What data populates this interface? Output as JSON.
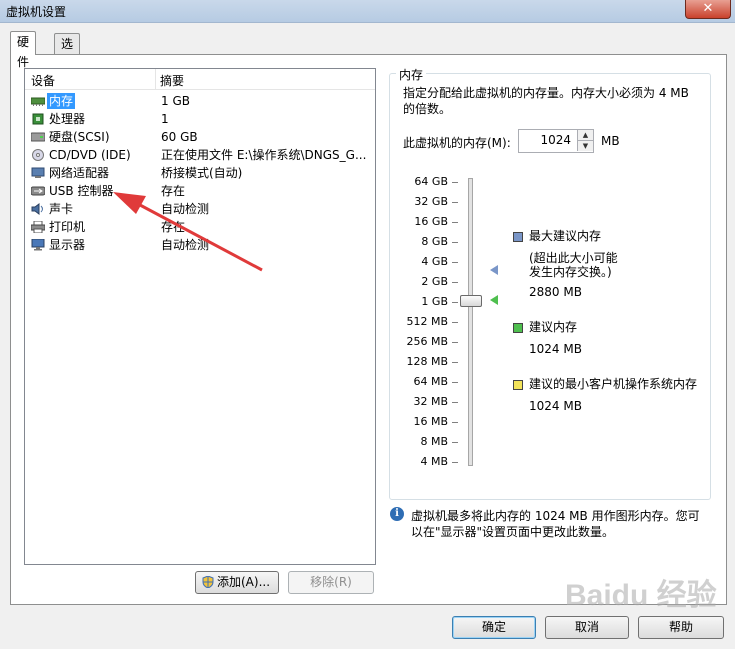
{
  "window": {
    "title": "虚拟机设置",
    "close_glyph": "✕"
  },
  "tabs": [
    {
      "label": "硬件"
    },
    {
      "label": "选项"
    }
  ],
  "device_list": {
    "columns": [
      "设备",
      "摘要"
    ],
    "rows": [
      {
        "name": "内存",
        "summary": "1 GB",
        "icon": "memory-icon"
      },
      {
        "name": "处理器",
        "summary": "1",
        "icon": "processor-icon"
      },
      {
        "name": "硬盘(SCSI)",
        "summary": "60 GB",
        "icon": "hard-disk-icon"
      },
      {
        "name": "CD/DVD (IDE)",
        "summary": "正在使用文件 E:\\操作系统\\DNGS_G...",
        "icon": "cd-dvd-icon"
      },
      {
        "name": "网络适配器",
        "summary": "桥接模式(自动)",
        "icon": "network-adapter-icon"
      },
      {
        "name": "USB 控制器",
        "summary": "存在",
        "icon": "usb-icon"
      },
      {
        "name": "声卡",
        "summary": "自动检测",
        "icon": "sound-card-icon"
      },
      {
        "name": "打印机",
        "summary": "存在",
        "icon": "printer-icon"
      },
      {
        "name": "显示器",
        "summary": "自动检测",
        "icon": "display-icon"
      }
    ]
  },
  "buttons": {
    "add": "添加(A)...",
    "remove": "移除(R)",
    "ok": "确定",
    "cancel": "取消",
    "help": "帮助"
  },
  "memory": {
    "group_title": "内存",
    "description": "指定分配给此虚拟机的内存量。内存大小必须为 4 MB 的倍数。",
    "label": "此虚拟机的内存(M):",
    "value": "1024",
    "unit": "MB",
    "scale": [
      "64 GB",
      "32 GB",
      "16 GB",
      "8 GB",
      "4 GB",
      "2 GB",
      "1 GB",
      "512 MB",
      "256 MB",
      "128 MB",
      "64 MB",
      "32 MB",
      "16 MB",
      "8 MB",
      "4 MB"
    ],
    "legend": {
      "max_title": "最大建议内存",
      "max_note_1": "(超出此大小可能",
      "max_note_2": "发生内存交换。)",
      "max_value": "2880 MB",
      "rec_title": "建议内存",
      "rec_value": "1024 MB",
      "min_title": "建议的最小客户机操作系统内存",
      "min_value": "1024 MB"
    },
    "colors": {
      "max": "#7a96c8",
      "recommended": "#4fbf4f",
      "minimum": "#f2e35a"
    }
  },
  "info": {
    "text": "虚拟机最多将此内存的 1024 MB 用作图形内存。您可以在\"显示器\"设置页面中更改此数量。"
  },
  "watermark": "Baidu 经验"
}
